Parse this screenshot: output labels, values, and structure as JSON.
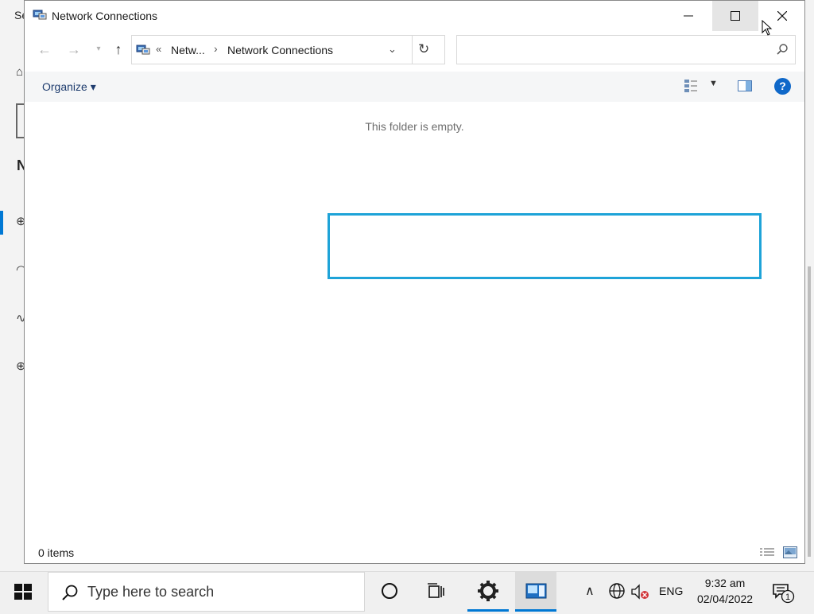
{
  "background_app": {
    "title_fragment": "Se",
    "heading_fragment": "N"
  },
  "window": {
    "title": "Network Connections",
    "controls": {
      "minimize": "—",
      "maximize": "☐",
      "close": "✕"
    }
  },
  "navigation": {
    "address_parts": [
      "Netw...",
      "Network Connections"
    ],
    "address_prefix": "«",
    "separator": "›",
    "search_placeholder": ""
  },
  "command_bar": {
    "organize_label": "Organize ▾"
  },
  "content": {
    "empty_message": "This folder is empty."
  },
  "status_bar": {
    "items_count": "0 items"
  },
  "taskbar": {
    "search_placeholder": "Type here to search",
    "language": "ENG",
    "time": "9:32 am",
    "date": "02/04/2022",
    "notification_count": "1"
  },
  "colors": {
    "accent": "#0078d4",
    "highlight_border": "#1ea3d8",
    "help_icon": "#0f68c9",
    "organize_text": "#1e3c6e"
  }
}
